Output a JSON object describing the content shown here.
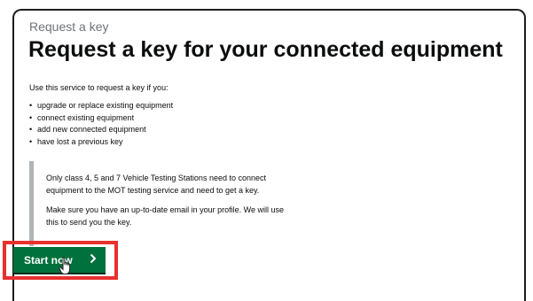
{
  "page": {
    "caption": "Request a key",
    "title": "Request a key for your connected equipment",
    "intro": "Use this service to request a key if you:",
    "bullets": [
      "upgrade or replace existing equipment",
      "connect existing equipment",
      "add new connected equipment",
      "have lost a previous key"
    ],
    "inset": {
      "paragraph1": "Only class 4, 5 and 7 Vehicle Testing Stations need to connect equipment to the MOT testing service and need to get a key.",
      "paragraph2": "Make sure you have an up-to-date email in your profile. We will use this to send you the key."
    },
    "start_button": {
      "label": "Start now",
      "icon": "chevron-right-icon",
      "color": "#00703c"
    }
  },
  "colors": {
    "highlight": "#e8302e",
    "inset_border": "#b1b4b6",
    "text": "#0b0c0c"
  }
}
